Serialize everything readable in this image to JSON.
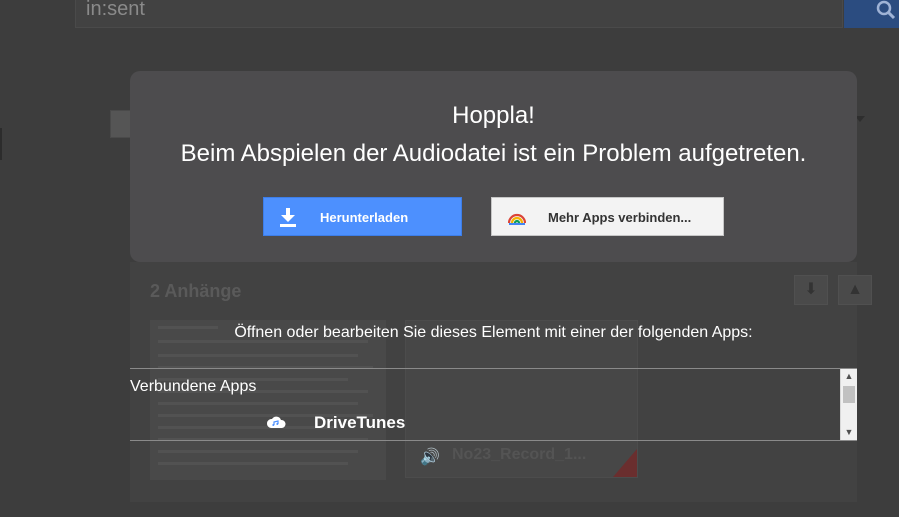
{
  "background": {
    "search_text": "in:sent",
    "heading": "2 Anhänge",
    "filename": "No23_Record_1..."
  },
  "dialog": {
    "title_line1": "Hoppla!",
    "title_line2": "Beim Abspielen der Audiodatei ist ein Problem aufgetreten.",
    "download_label": "Herunterladen",
    "connect_apps_label": "Mehr Apps verbinden..."
  },
  "open_with": {
    "prompt": "Öffnen oder bearbeiten Sie dieses Element mit einer der folgenden Apps:",
    "section_label": "Verbundene Apps",
    "apps": [
      {
        "name": "DriveTunes",
        "icon": "cloud-icon"
      }
    ]
  },
  "colors": {
    "dialog_bg": "#4d4c4e",
    "download_button": "#4d90fe",
    "overlay": "#3b3b3b"
  }
}
